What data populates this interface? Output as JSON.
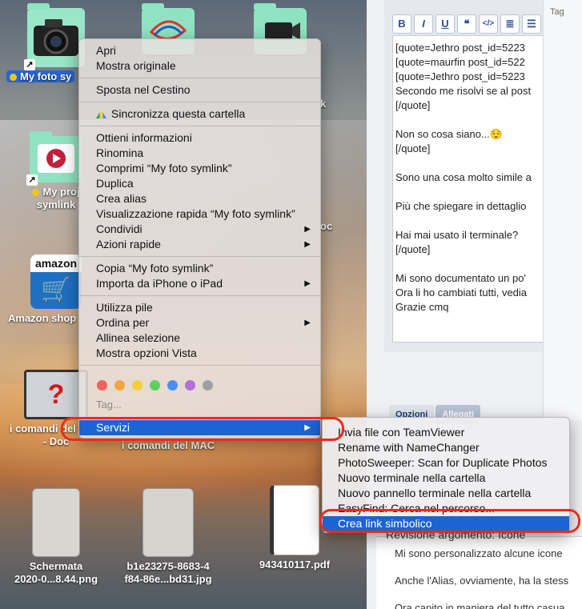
{
  "desktop": {
    "icons": [
      {
        "label": "My foto sy",
        "kind": "camera"
      },
      {
        "label": "",
        "kind": "logo"
      },
      {
        "label": "",
        "kind": "videocam"
      },
      {
        "label_line1": "My proj",
        "label_line2": "symlink"
      },
      {
        "label_right": "k"
      },
      {
        "label_right": "oc"
      },
      {
        "label": "Amazon shop",
        "brand": "amazon"
      },
      {
        "label_line1": "i comandi del MAC",
        "label_line2": "- Doc"
      },
      {
        "label": "i comandi del MAC"
      },
      {
        "label_line1": "Schermata",
        "label_line2": "2020-0...8.44.png"
      },
      {
        "label_line1": "b1e23275-8683-4",
        "label_line2": "f84-86e...bd31.jpg"
      },
      {
        "label": "943410117.pdf"
      }
    ]
  },
  "editor": {
    "toolbar": [
      "B",
      "I",
      "U",
      "❝",
      "</>",
      "≣",
      "☰"
    ],
    "lines": [
      "[quote=Jethro post_id=5223",
      "[quote=maurfin post_id=522",
      "[quote=Jethro post_id=5223",
      "Secondo me risolvi se al post",
      "[/quote]",
      "",
      "Non so cosa siano...😌",
      "[/quote]",
      "",
      "Sono una cosa molto simile a",
      "",
      "Più che spiegare in dettaglio",
      "",
      "Hai mai usato il terminale?",
      "[/quote]",
      "",
      "Mi sono documentato un po'",
      "Ora li ho cambiati tutti, vedia",
      "Grazie cmq"
    ],
    "tag_label": "Tag",
    "tabs": [
      "Opzioni",
      "Allegati"
    ],
    "review_title": "Revisione argomento: Icone",
    "review_lines": [
      "Mi sono personalizzato alcune icone",
      "Anche l'Alias, ovviamente, ha la stess",
      "Ora capito in maniera del tutto casua"
    ]
  },
  "context_menu": {
    "items": [
      {
        "label": "Apri"
      },
      {
        "label": "Mostra originale"
      },
      {
        "sep": true
      },
      {
        "label": "Sposta nel Cestino"
      },
      {
        "sep": true
      },
      {
        "label": "Sincronizza questa cartella",
        "icon": "google-drive-icon"
      },
      {
        "sep": true
      },
      {
        "label": "Ottieni informazioni"
      },
      {
        "label": "Rinomina"
      },
      {
        "label": "Comprimi “My foto symlink”"
      },
      {
        "label": "Duplica"
      },
      {
        "label": "Crea alias"
      },
      {
        "label": "Visualizzazione rapida “My foto symlink”"
      },
      {
        "label": "Condividi",
        "submenu": true
      },
      {
        "label": "Azioni rapide",
        "submenu": true
      },
      {
        "sep": true
      },
      {
        "label": "Copia “My foto symlink”"
      },
      {
        "label": "Importa da iPhone o iPad",
        "submenu": true
      },
      {
        "sep": true
      },
      {
        "label": "Utilizza pile"
      },
      {
        "label": "Ordina per",
        "submenu": true
      },
      {
        "label": "Allinea selezione"
      },
      {
        "label": "Mostra opzioni Vista"
      },
      {
        "sep": true
      },
      {
        "label": "Servizi",
        "submenu": true,
        "highlighted": true
      }
    ],
    "tag_colors": [
      "#f0645c",
      "#f5a440",
      "#f5cf3c",
      "#5fcf62",
      "#4a8ff4",
      "#b270dc",
      "#a0a0a4"
    ],
    "tag_label": "Tag..."
  },
  "services_menu": {
    "items": [
      {
        "label": "Invia file con TeamViewer"
      },
      {
        "label": "Rename with NameChanger"
      },
      {
        "label": "PhotoSweeper: Scan for Duplicate Photos"
      },
      {
        "label": "Nuovo terminale nella cartella"
      },
      {
        "label": "Nuovo pannello terminale nella cartella"
      },
      {
        "label": "EasyFind: Cerca nel percorso..."
      },
      {
        "label": "Crea link simbolico",
        "highlighted": true
      }
    ]
  },
  "colors": {
    "highlight": "#1b64d4",
    "annotation": "#ee2b1a",
    "folder": "#8fe3c2"
  }
}
